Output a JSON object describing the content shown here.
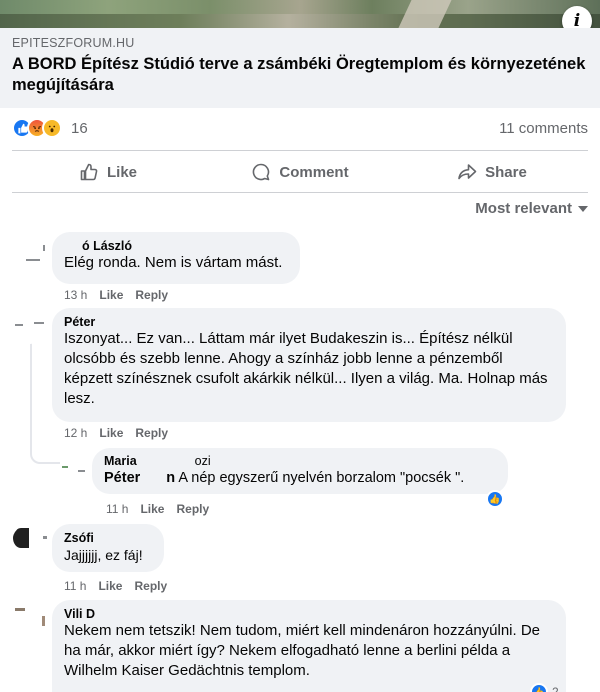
{
  "post": {
    "info_icon": "info-icon",
    "link": {
      "domain": "EPITESZFORUM.HU",
      "title": "A BORD Építész Stúdió terve a zsámbéki Öregtemplom és környezetének megújítására"
    },
    "reactions": {
      "icons": [
        "like-icon",
        "angry-icon",
        "wow-icon"
      ],
      "count": "16"
    },
    "comments_count": "11 comments",
    "actions": {
      "like": "Like",
      "comment": "Comment",
      "share": "Share"
    },
    "sort_label": "Most relevant"
  },
  "comments": [
    {
      "author": "ó László",
      "text": "Elég ronda. Nem is vártam mást.",
      "time": "13 h",
      "like": "Like",
      "reply": "Reply"
    },
    {
      "author": "Péter",
      "text": "Iszonyat... Ez van... Láttam már ilyet Budakeszin is... Építész nélkül olcsóbb és szebb lenne. Ahogy a színház jobb lenne a pénzemből képzett színésznek csufolt akárkik nélkül... Ilyen a világ. Ma. Holnap más lesz.",
      "time": "12 h",
      "like": "Like",
      "reply": "Reply"
    },
    {
      "author": "Maria",
      "author_suffix": "ozi",
      "tag": "Péter",
      "tag_suffix": "n",
      "text": " A nép egyszerű nyelvén borzalom \"pocsék \".",
      "time": "11 h",
      "like": "Like",
      "reply": "Reply"
    },
    {
      "author": "Zsófi",
      "text": "Jajjjjjj, ez fáj!",
      "time": "11 h",
      "like": "Like",
      "reply": "Reply"
    },
    {
      "author": "Vili D",
      "text": "Nekem nem tetszik! Nem tudom, miért kell mindenáron hozzányúlni. De ha már, akkor miért így? Nekem elfogadható lenne a berlini példa a Wilhelm Kaiser Gedächtnis templom.",
      "reaction_count": "2"
    }
  ]
}
